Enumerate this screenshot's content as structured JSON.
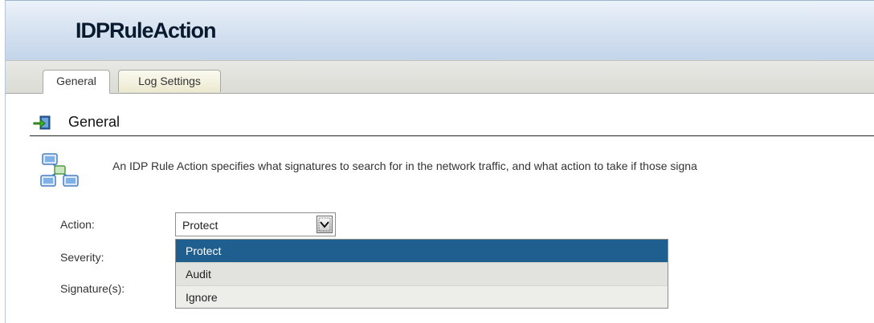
{
  "header": {
    "title": "IDPRuleAction"
  },
  "tabs": [
    {
      "label": "General",
      "active": true
    },
    {
      "label": "Log Settings",
      "active": false
    }
  ],
  "section": {
    "title": "General",
    "icon": "arrow-right-icon",
    "description": "An IDP Rule Action specifies what signatures to search for in the network traffic, and what action to take if those signa"
  },
  "form": {
    "action_label": "Action:",
    "action_value": "Protect",
    "severity_label": "Severity:",
    "signatures_label": "Signature(s):"
  },
  "dropdown": {
    "options": [
      "Protect",
      "Audit",
      "Ignore"
    ],
    "selected": "Protect"
  },
  "colors": {
    "header_gradient": "#c4d5ea",
    "selected_option": "#1e5f8f"
  }
}
